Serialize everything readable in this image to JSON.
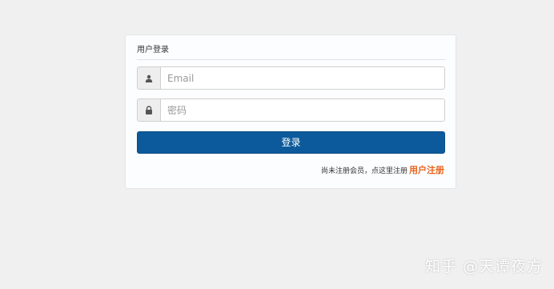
{
  "login_panel": {
    "title": "用户登录",
    "email": {
      "icon": "user-icon",
      "placeholder": "Email",
      "value": ""
    },
    "password": {
      "icon": "lock-icon",
      "placeholder": "密码",
      "value": ""
    },
    "submit_label": "登录",
    "register": {
      "hint": "尚未注册会员，点这里注册",
      "link_label": "用户注册"
    }
  },
  "watermark": {
    "text": "知乎 @天谭夜方"
  },
  "colors": {
    "page_background": "#f0f0f0",
    "button_primary": "#0c5a9c",
    "register_link": "#e8641e"
  }
}
